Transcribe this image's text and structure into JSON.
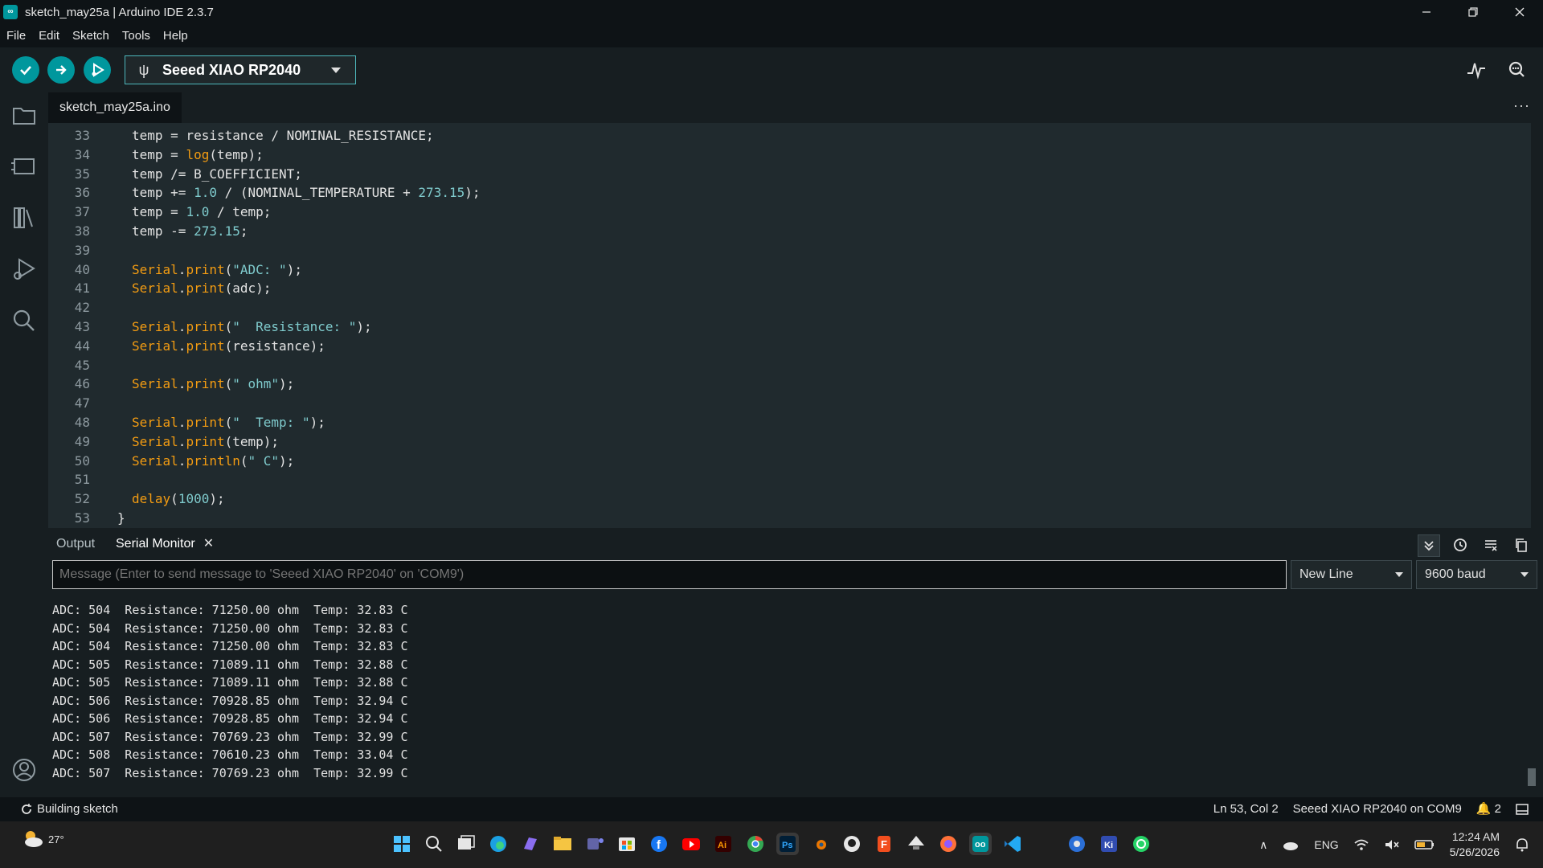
{
  "window": {
    "title": "sketch_may25a | Arduino IDE 2.3.7",
    "controls": [
      "minimize-icon",
      "restore-icon",
      "close-icon"
    ]
  },
  "menu": [
    "File",
    "Edit",
    "Sketch",
    "Tools",
    "Help"
  ],
  "toolbar": {
    "board": "Seeed XIAO RP2040",
    "verify_icon": "check-icon",
    "upload_icon": "arrow-right-icon",
    "debug_icon": "debug-icon",
    "plotter_icon": "serial-plotter-icon",
    "monitor_icon": "serial-monitor-icon"
  },
  "activity_bar": [
    "folder-icon",
    "board-manager-icon",
    "library-icon",
    "debug-icon",
    "search-icon",
    "account-icon"
  ],
  "editor": {
    "tab": "sketch_may25a.ino",
    "lines": [
      {
        "n": "33",
        "parts": [
          [
            "t",
            "temp = resistance / NOMINAL_RESISTANCE;"
          ]
        ]
      },
      {
        "n": "34",
        "parts": [
          [
            "t",
            "temp = "
          ],
          [
            "f",
            "log"
          ],
          [
            "t",
            "(temp);"
          ]
        ]
      },
      {
        "n": "35",
        "parts": [
          [
            "t",
            "temp /= B_COEFFICIENT;"
          ]
        ]
      },
      {
        "n": "36",
        "parts": [
          [
            "t",
            "temp += "
          ],
          [
            "n",
            "1.0"
          ],
          [
            "t",
            " / (NOMINAL_TEMPERATURE + "
          ],
          [
            "n",
            "273.15"
          ],
          [
            "t",
            ");"
          ]
        ]
      },
      {
        "n": "37",
        "parts": [
          [
            "t",
            "temp = "
          ],
          [
            "n",
            "1.0"
          ],
          [
            "t",
            " / temp;"
          ]
        ]
      },
      {
        "n": "38",
        "parts": [
          [
            "t",
            "temp -= "
          ],
          [
            "n",
            "273.15"
          ],
          [
            "t",
            ";"
          ]
        ]
      },
      {
        "n": "39",
        "parts": []
      },
      {
        "n": "40",
        "parts": [
          [
            "f",
            "Serial"
          ],
          [
            "t",
            "."
          ],
          [
            "f",
            "print"
          ],
          [
            "t",
            "("
          ],
          [
            "s",
            "\"ADC: \""
          ],
          [
            "t",
            ");"
          ]
        ]
      },
      {
        "n": "41",
        "parts": [
          [
            "f",
            "Serial"
          ],
          [
            "t",
            "."
          ],
          [
            "f",
            "print"
          ],
          [
            "t",
            "(adc);"
          ]
        ]
      },
      {
        "n": "42",
        "parts": []
      },
      {
        "n": "43",
        "parts": [
          [
            "f",
            "Serial"
          ],
          [
            "t",
            "."
          ],
          [
            "f",
            "print"
          ],
          [
            "t",
            "("
          ],
          [
            "s",
            "\"  Resistance: \""
          ],
          [
            "t",
            ");"
          ]
        ]
      },
      {
        "n": "44",
        "parts": [
          [
            "f",
            "Serial"
          ],
          [
            "t",
            "."
          ],
          [
            "f",
            "print"
          ],
          [
            "t",
            "(resistance);"
          ]
        ]
      },
      {
        "n": "45",
        "parts": []
      },
      {
        "n": "46",
        "parts": [
          [
            "f",
            "Serial"
          ],
          [
            "t",
            "."
          ],
          [
            "f",
            "print"
          ],
          [
            "t",
            "("
          ],
          [
            "s",
            "\" ohm\""
          ],
          [
            "t",
            ");"
          ]
        ]
      },
      {
        "n": "47",
        "parts": []
      },
      {
        "n": "48",
        "parts": [
          [
            "f",
            "Serial"
          ],
          [
            "t",
            "."
          ],
          [
            "f",
            "print"
          ],
          [
            "t",
            "("
          ],
          [
            "s",
            "\"  Temp: \""
          ],
          [
            "t",
            ");"
          ]
        ]
      },
      {
        "n": "49",
        "parts": [
          [
            "f",
            "Serial"
          ],
          [
            "t",
            "."
          ],
          [
            "f",
            "print"
          ],
          [
            "t",
            "(temp);"
          ]
        ]
      },
      {
        "n": "50",
        "parts": [
          [
            "f",
            "Serial"
          ],
          [
            "t",
            "."
          ],
          [
            "f",
            "println"
          ],
          [
            "t",
            "("
          ],
          [
            "s",
            "\" C\""
          ],
          [
            "t",
            ");"
          ]
        ]
      },
      {
        "n": "51",
        "parts": []
      },
      {
        "n": "52",
        "parts": [
          [
            "f",
            "delay"
          ],
          [
            "t",
            "("
          ],
          [
            "n",
            "1000"
          ],
          [
            "t",
            ");"
          ]
        ]
      },
      {
        "n": "53",
        "parts": [
          [
            "t",
            "}"
          ]
        ]
      }
    ]
  },
  "panel": {
    "tabs": [
      "Output",
      "Serial Monitor"
    ],
    "active_tab": "Serial Monitor",
    "message_placeholder": "Message (Enter to send message to 'Seeed XIAO RP2040' on 'COM9')",
    "line_ending": "New Line",
    "baud": "9600 baud",
    "serial_lines": [
      "ADC: 504  Resistance: 71250.00 ohm  Temp: 32.83 C",
      "ADC: 504  Resistance: 71250.00 ohm  Temp: 32.83 C",
      "ADC: 504  Resistance: 71250.00 ohm  Temp: 32.83 C",
      "ADC: 505  Resistance: 71089.11 ohm  Temp: 32.88 C",
      "ADC: 505  Resistance: 71089.11 ohm  Temp: 32.88 C",
      "ADC: 506  Resistance: 70928.85 ohm  Temp: 32.94 C",
      "ADC: 506  Resistance: 70928.85 ohm  Temp: 32.94 C",
      "ADC: 507  Resistance: 70769.23 ohm  Temp: 32.99 C",
      "ADC: 508  Resistance: 70610.23 ohm  Temp: 33.04 C",
      "ADC: 507  Resistance: 70769.23 ohm  Temp: 32.99 C"
    ]
  },
  "status": {
    "left": "Building sketch",
    "position": "Ln 53, Col 2",
    "board_port": "Seeed XIAO RP2040 on COM9",
    "notifications": "2"
  },
  "taskbar": {
    "weather": "27°",
    "language": "ENG",
    "time": "12:24 AM",
    "date": "5/26/2026"
  },
  "colors": {
    "accent": "#00979d",
    "editor_bg": "#202a2e",
    "chrome_bg": "#171e21",
    "function": "#f39c12",
    "literal": "#7fcbcd"
  }
}
